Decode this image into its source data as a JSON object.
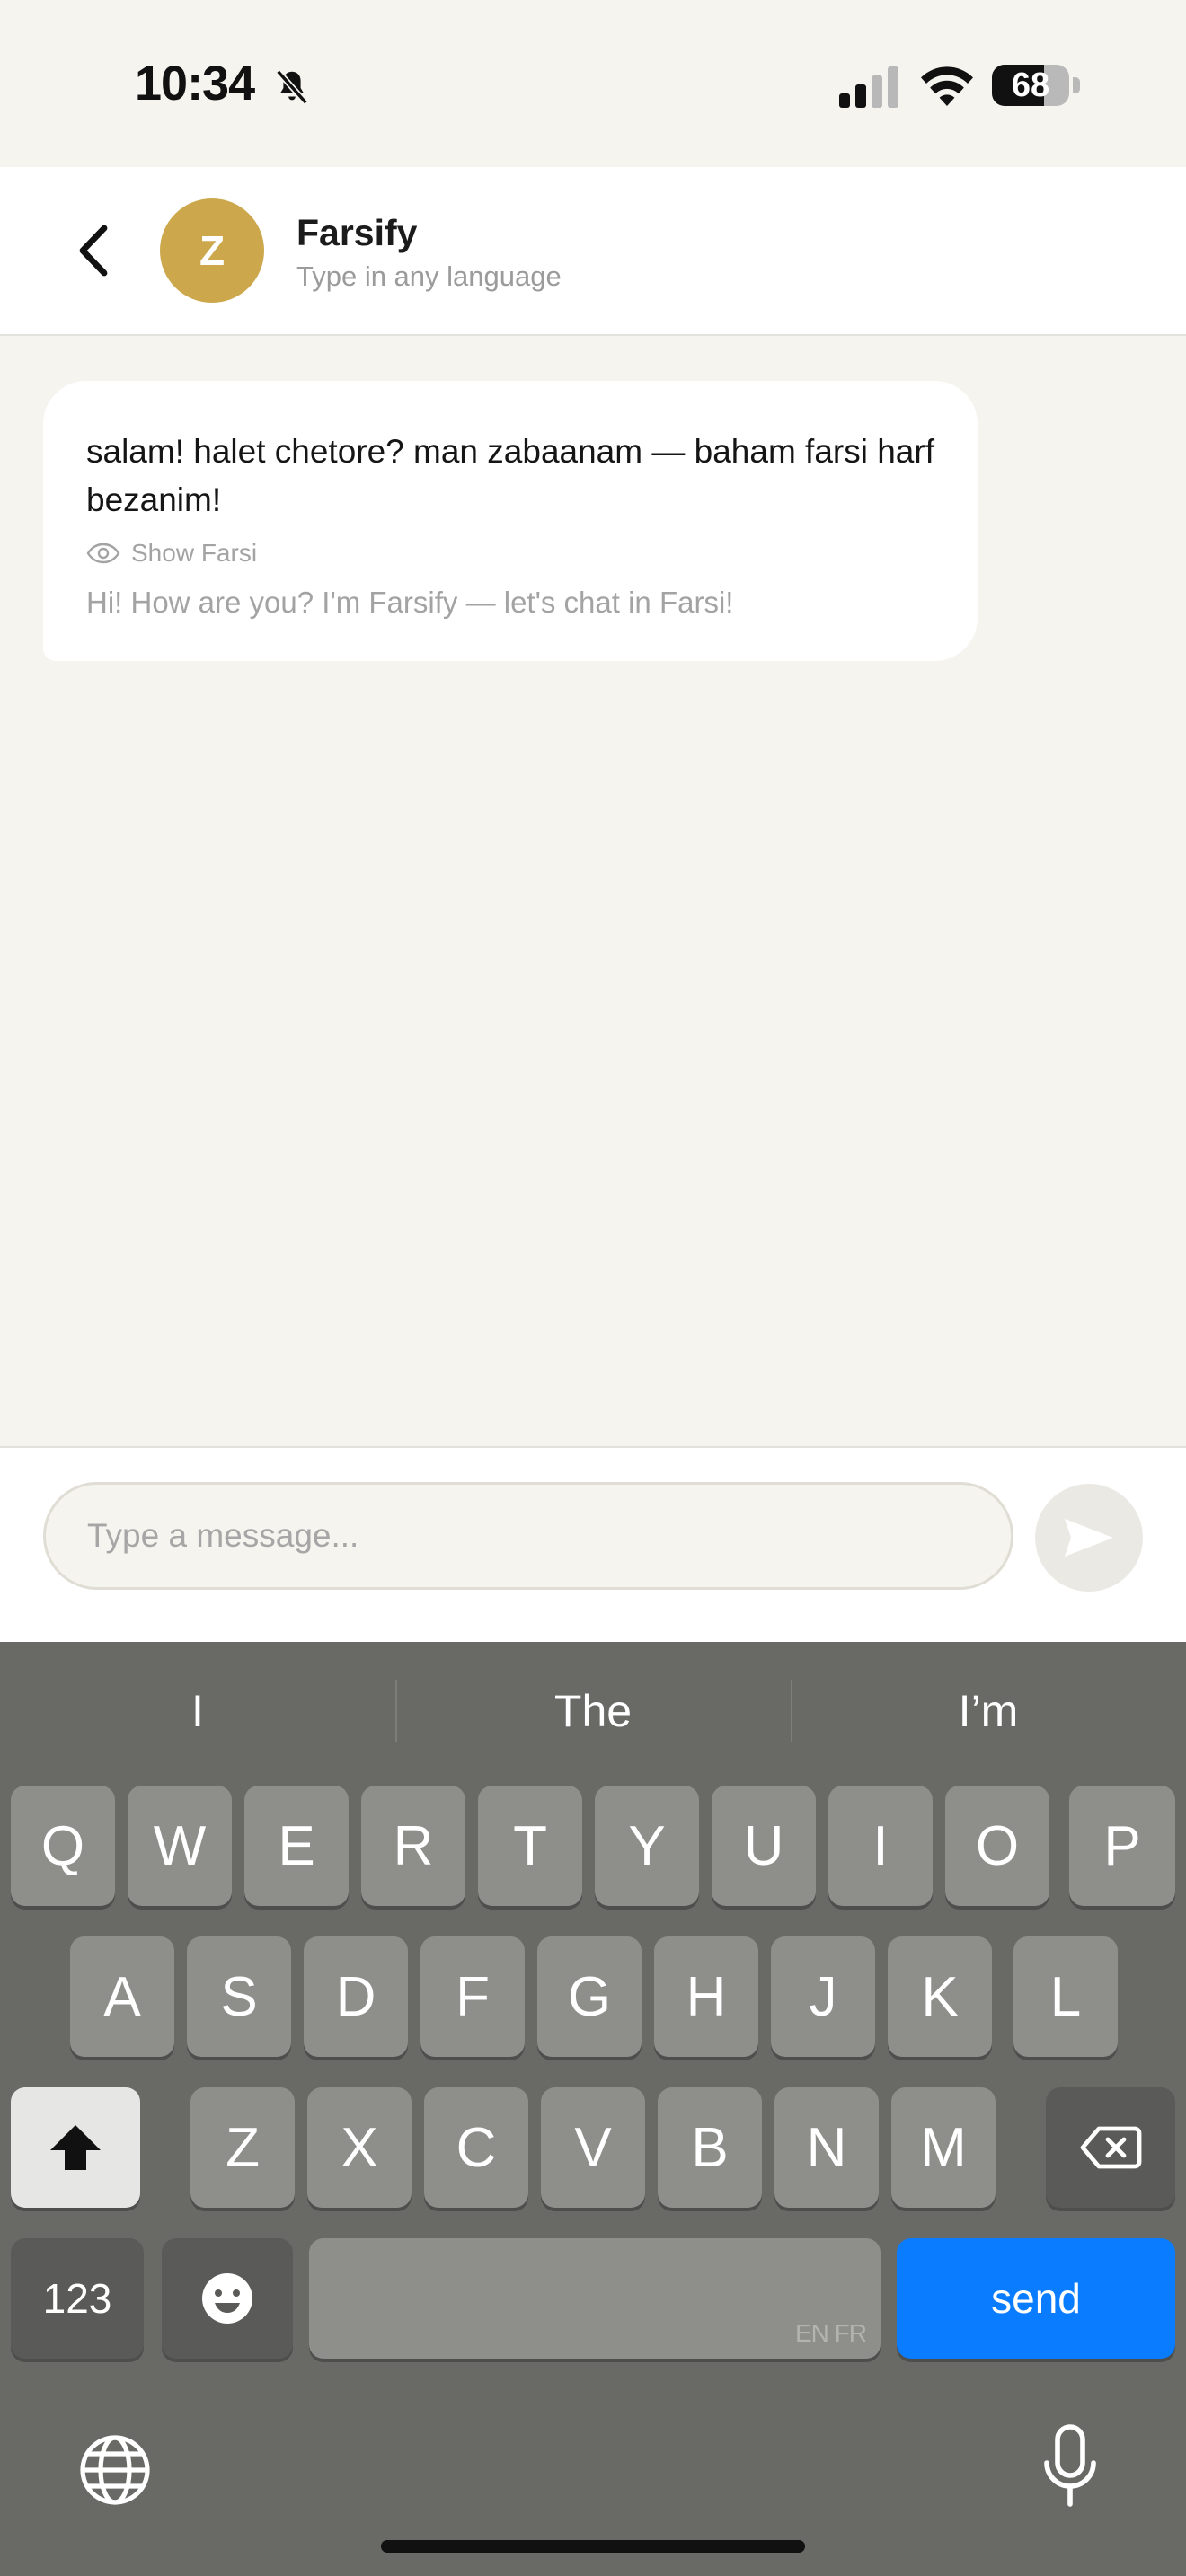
{
  "status_bar": {
    "time": "10:34",
    "battery": "68",
    "battery_level": 0.68,
    "icons": [
      "bell-slash-icon",
      "cellular-signal-icon",
      "wifi-icon",
      "battery-icon"
    ]
  },
  "header": {
    "avatar_initial": "Z",
    "title": "Farsify",
    "subtitle": "Type in any language",
    "back_icon": "chevron-left-icon"
  },
  "messages": [
    {
      "text": "salam! halet chetore? man zabaanam — baham farsi harf bezanim!",
      "show_farsi_label": "Show Farsi",
      "translation": "Hi! How are you? I'm Farsify — let's chat in Farsi!"
    }
  ],
  "composer": {
    "placeholder": "Type a message...",
    "send_icon": "paper-plane-icon"
  },
  "keyboard": {
    "suggestions": [
      "I",
      "The",
      "I’m"
    ],
    "rows": [
      [
        "Q",
        "W",
        "E",
        "R",
        "T",
        "Y",
        "U",
        "I",
        "O",
        "P"
      ],
      [
        "A",
        "S",
        "D",
        "F",
        "G",
        "H",
        "J",
        "K",
        "L"
      ],
      [
        "Z",
        "X",
        "C",
        "V",
        "B",
        "N",
        "M"
      ]
    ],
    "numbers_label": "123",
    "space_languages": "EN FR",
    "send_label": "send",
    "icons": [
      "shift-icon",
      "backspace-icon",
      "emoji-icon",
      "globe-icon",
      "microphone-icon"
    ]
  },
  "colors": {
    "accent": "#CCA74B",
    "send_key": "#0A7CFF",
    "background": "#F6F4EF"
  }
}
